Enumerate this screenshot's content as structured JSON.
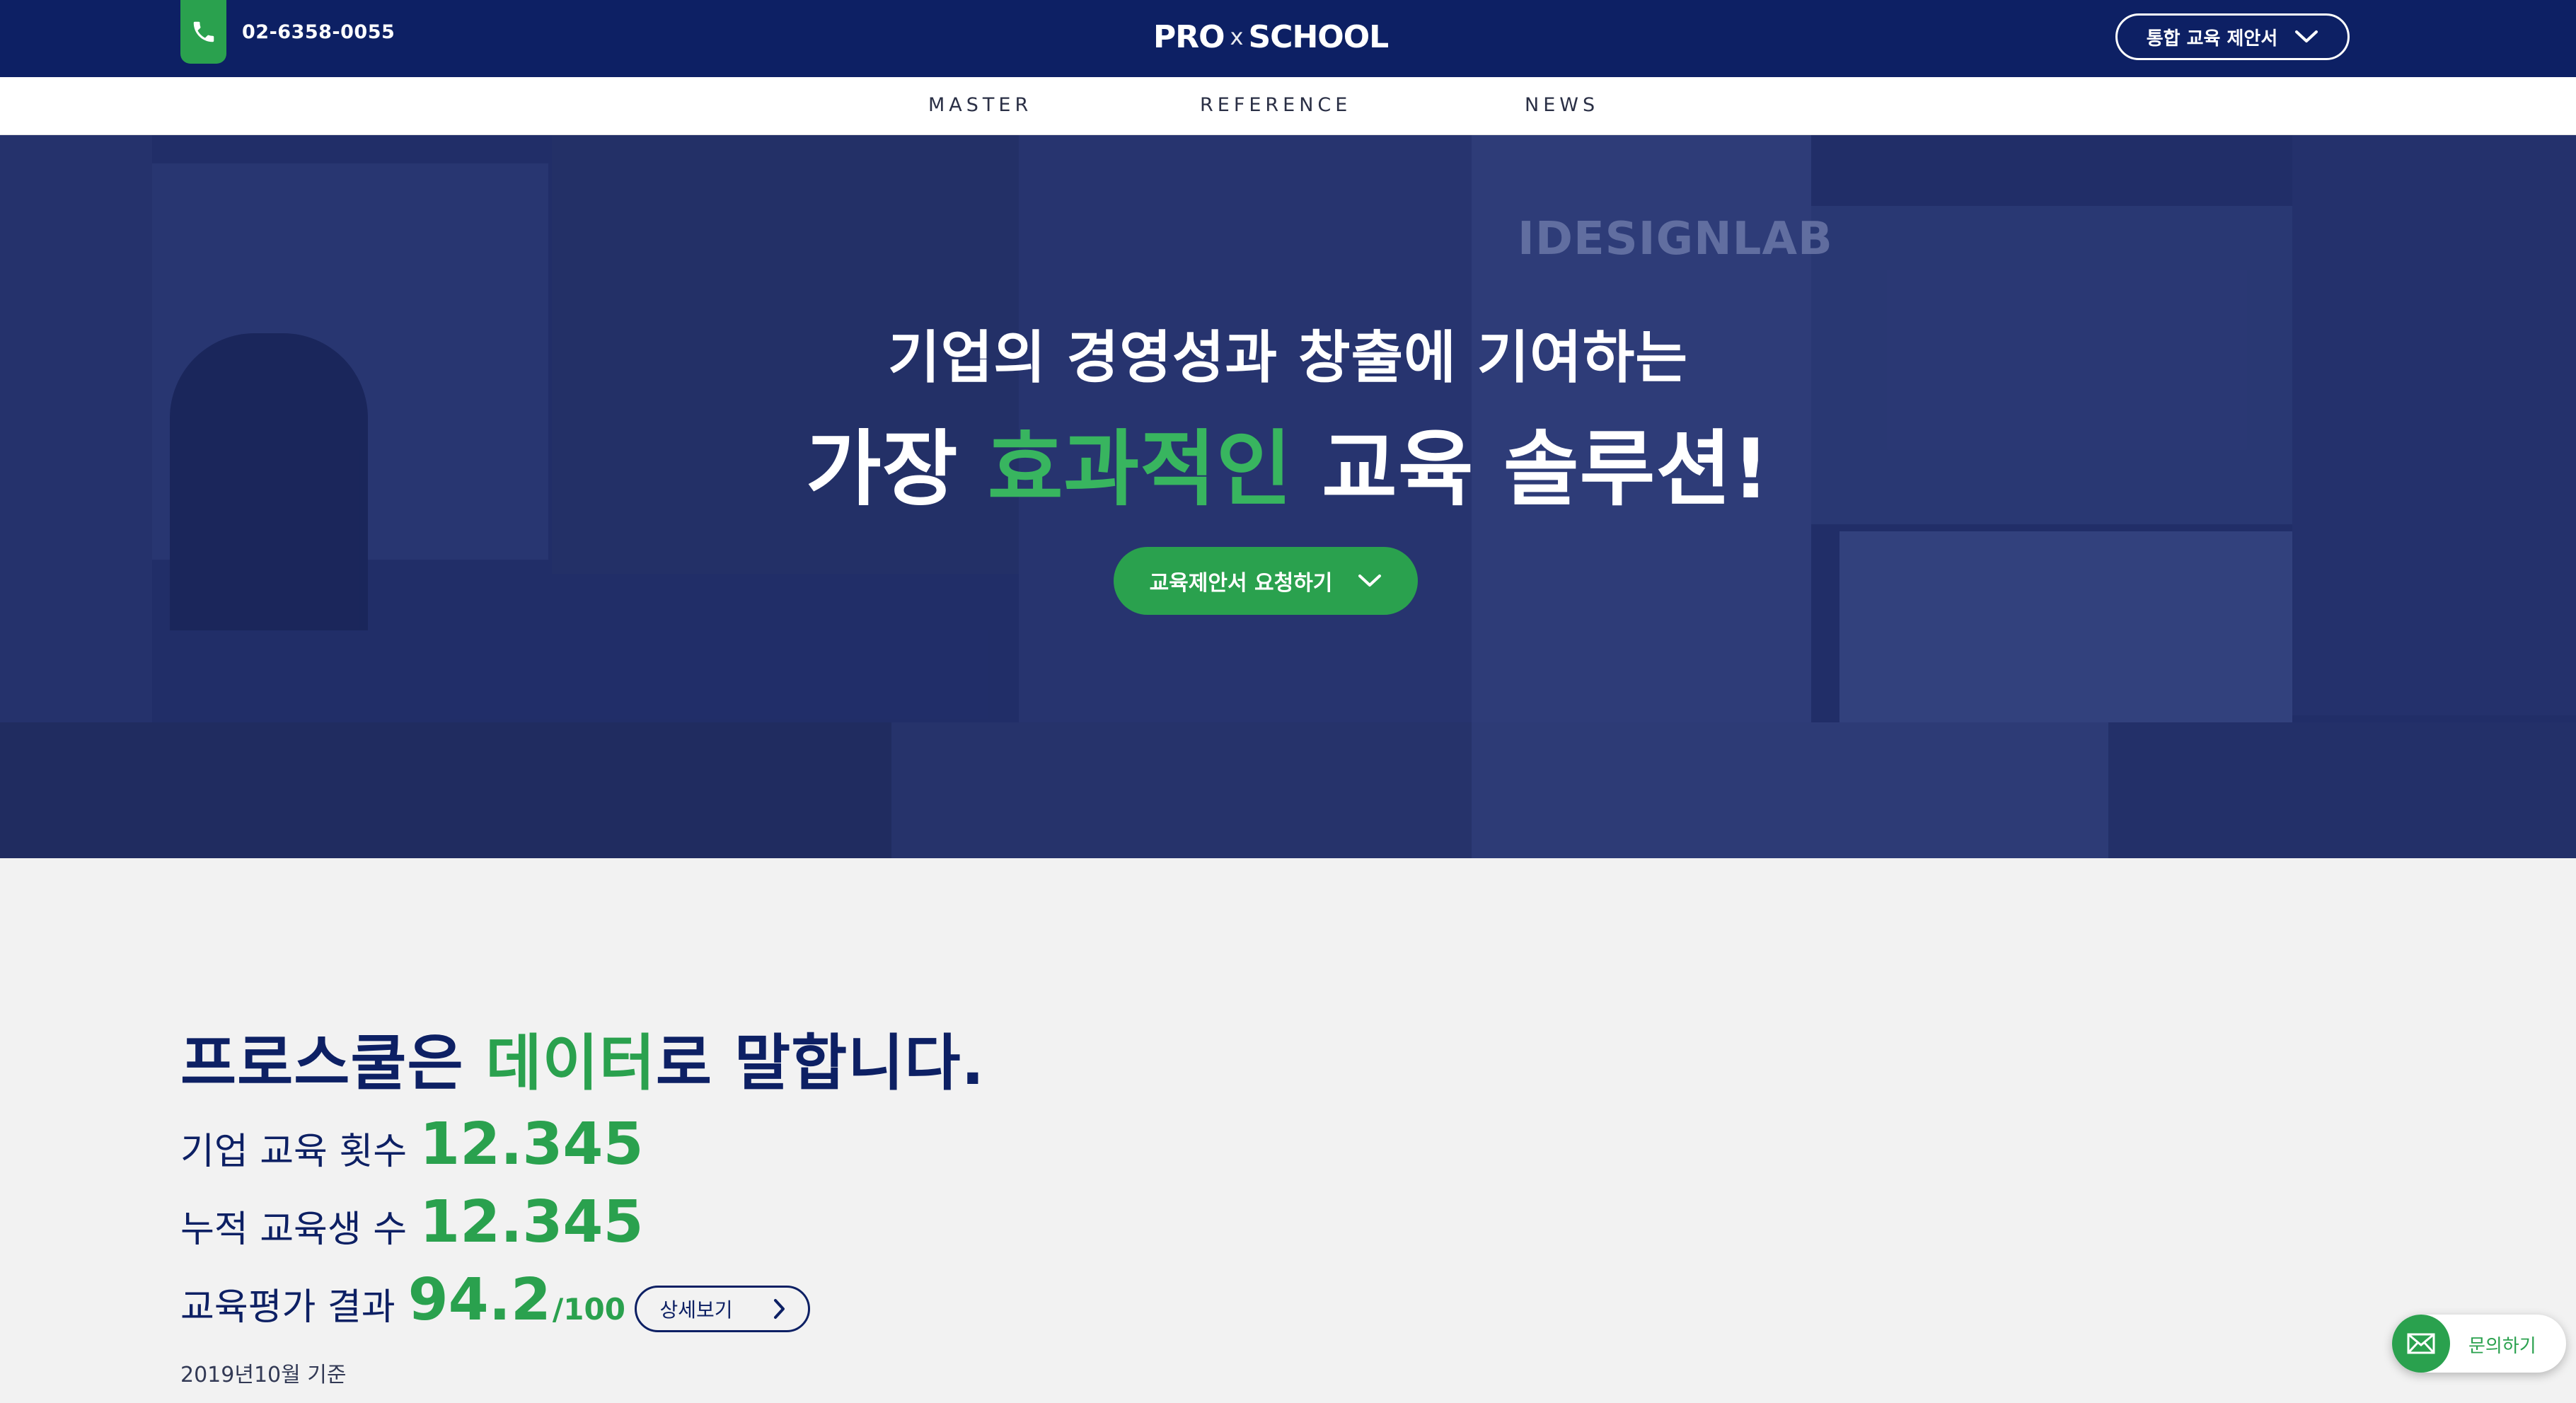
{
  "header": {
    "phone": "02-6358-0055",
    "logo_left": "PRO",
    "logo_x": "x",
    "logo_right": "SCHOOL",
    "proposal_button": "통합 교육 제안서"
  },
  "nav": {
    "items": [
      "MASTER",
      "REFERENCE",
      "NEWS"
    ]
  },
  "hero": {
    "line1": "기업의 경영성과 창출에 기여하는",
    "line2_prefix": "가장 ",
    "line2_highlight": "효과적인",
    "line2_suffix": " 교육 솔루션!",
    "cta": "교육제안서 요청하기",
    "background_sign": "IDESIGNLAB"
  },
  "stats": {
    "title_prefix": "프로스쿨은 ",
    "title_highlight": "데이터",
    "title_suffix": "로 말합니다.",
    "rows": [
      {
        "label": "기업 교육 횟수",
        "value": "12.345",
        "suffix": ""
      },
      {
        "label": "누적 교육생 수",
        "value": "12.345",
        "suffix": ""
      },
      {
        "label": "교육평가 결과",
        "value": "94.2",
        "suffix": "/100"
      }
    ],
    "detail_button": "상세보기",
    "note": "2019년10월 기준"
  },
  "floating": {
    "inquiry": "문의하기"
  },
  "colors": {
    "navy": "#0d2064",
    "green": "#2aa14e",
    "hero_bg": "#27346b",
    "section_bg": "#f2f2f2"
  },
  "icons": {
    "phone": "phone-icon",
    "proposal_chevron": "chevron-down-icon",
    "cta_chevron": "chevron-down-icon",
    "detail_chevron": "chevron-right-icon",
    "inquiry": "mail-icon"
  }
}
